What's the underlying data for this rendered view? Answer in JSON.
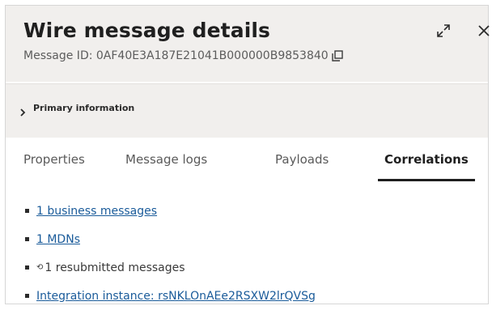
{
  "header": {
    "title": "Wire message details",
    "message_id_label": "Message ID: 0AF40E3A187E21041B000000B9853840"
  },
  "icons": {
    "copy": "copy-icon",
    "expand": "expand-icon",
    "close": "close-icon",
    "chevron": "chevron-right-icon"
  },
  "section": {
    "label": "Primary information"
  },
  "tabs": [
    {
      "label": "Properties"
    },
    {
      "label": "Message logs"
    },
    {
      "label": "Payloads"
    },
    {
      "label": "Correlations",
      "active": true
    }
  ],
  "correlations": [
    {
      "text": "1 business messages",
      "link": true
    },
    {
      "text": "1 MDNs",
      "link": true
    },
    {
      "text": "1 resubmitted messages",
      "link": false
    },
    {
      "text": "Integration instance: rsNKLOnAEe2RSXW2lrQVSg",
      "link": true
    }
  ]
}
